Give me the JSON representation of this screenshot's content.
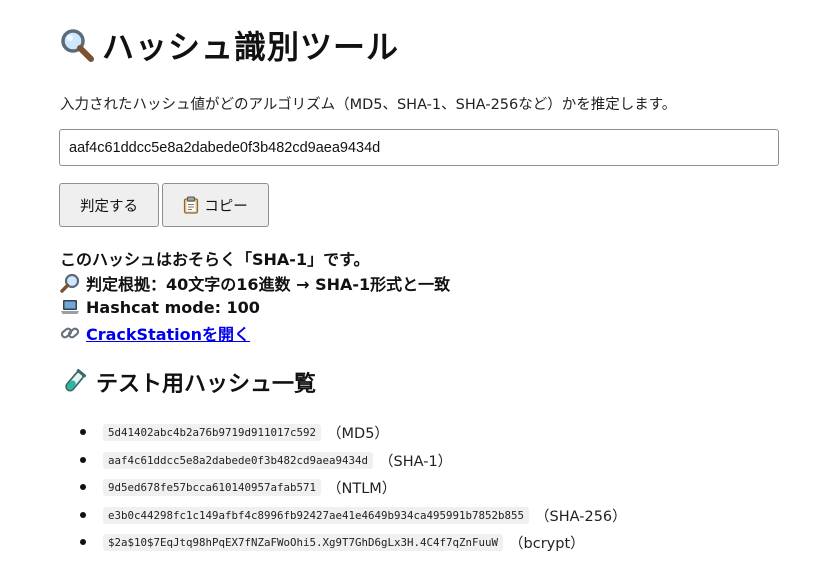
{
  "title": {
    "icon": "magnifier-icon",
    "text": "ハッシュ識別ツール"
  },
  "description": "入力されたハッシュ値がどのアルゴリズム（MD5、SHA-1、SHA-256など）かを推定します。",
  "input": {
    "value": "aaf4c61ddcc5e8a2dabede0f3b482cd9aea9434d"
  },
  "buttons": {
    "judge_label": "判定する",
    "copy_icon": "clipboard-icon",
    "copy_label": "コピー"
  },
  "result": {
    "line1": "このハッシュはおそらく「SHA-1」です。",
    "line2_icon": "magnifier-icon",
    "line2": "判定根拠：40文字の16進数 → SHA-1形式と一致",
    "line3_icon": "laptop-icon",
    "line3": "Hashcat mode: 100",
    "line4_icon": "link-icon",
    "line4_link": "CrackStationを開く"
  },
  "test_section": {
    "icon": "test-tube-icon",
    "heading": "テスト用ハッシュ一覧",
    "items": [
      {
        "hash": "5d41402abc4b2a76b9719d911017c592",
        "algo": "（MD5）"
      },
      {
        "hash": "aaf4c61ddcc5e8a2dabede0f3b482cd9aea9434d",
        "algo": "（SHA-1）"
      },
      {
        "hash": "9d5ed678fe57bcca610140957afab571",
        "algo": "（NTLM）"
      },
      {
        "hash": "e3b0c44298fc1c149afbf4c8996fb92427ae41e4649b934ca495991b7852b855",
        "algo": "（SHA-256）"
      },
      {
        "hash": "$2a$10$7EqJtq98hPqEX7fNZaFWoOhi5.Xg9T7GhD6gLx3H.4C4f7qZnFuuW",
        "algo": "（bcrypt）"
      }
    ]
  },
  "colors": {
    "link": "#0000ee",
    "button_bg": "#efefef",
    "code_bg": "#f0f0f0"
  }
}
